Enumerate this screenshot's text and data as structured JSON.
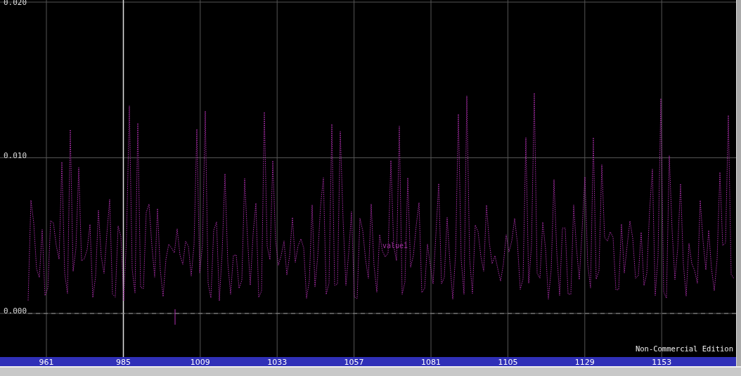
{
  "plot": {
    "y_ticks": [
      "0.020",
      "0.010",
      "0.000"
    ],
    "series_label": "value1",
    "edition_note": "Non-Commercial Edition"
  },
  "x_axis": {
    "ticks": [
      "961",
      "985",
      "1009",
      "1033",
      "1057",
      "1081",
      "1105",
      "1129",
      "1153"
    ]
  }
}
